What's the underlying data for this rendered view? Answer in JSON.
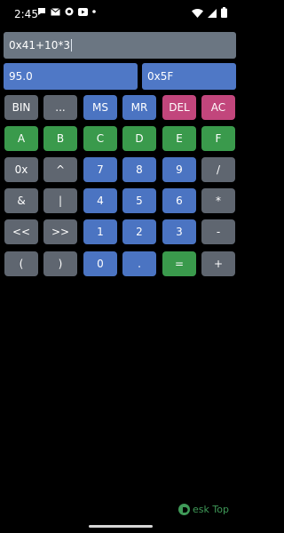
{
  "status_bar": {
    "time": "2:45",
    "left_icons": [
      "chat-bubble-icon",
      "mail-icon",
      "record-icon",
      "youtube-icon",
      "dot-icon"
    ],
    "right_icons": [
      "wifi-icon",
      "signal-icon",
      "battery-icon"
    ]
  },
  "expression": {
    "value": "0x41+10*3"
  },
  "results": {
    "decimal": "95.0",
    "hex": "0x5F"
  },
  "keypad": {
    "row1": [
      "BIN",
      "...",
      "MS",
      "MR",
      "DEL",
      "AC"
    ],
    "row2": [
      "A",
      "B",
      "C",
      "D",
      "E",
      "F"
    ],
    "row3": [
      "0x",
      "^",
      "7",
      "8",
      "9",
      "/"
    ],
    "row4": [
      "&",
      "|",
      "4",
      "5",
      "6",
      "*"
    ],
    "row5": [
      "<<",
      ">>",
      "1",
      "2",
      "3",
      "-"
    ],
    "row6": [
      "(",
      ")",
      "0",
      ".",
      "=",
      "+"
    ]
  },
  "colors": {
    "gray": "#5f6670",
    "blue": "#4b74c2",
    "pink": "#c2467c",
    "green": "#3a9a4c",
    "field": "#6b7682"
  },
  "watermark": {
    "text": "esk Top",
    "icon": "desktop-logo-icon"
  }
}
